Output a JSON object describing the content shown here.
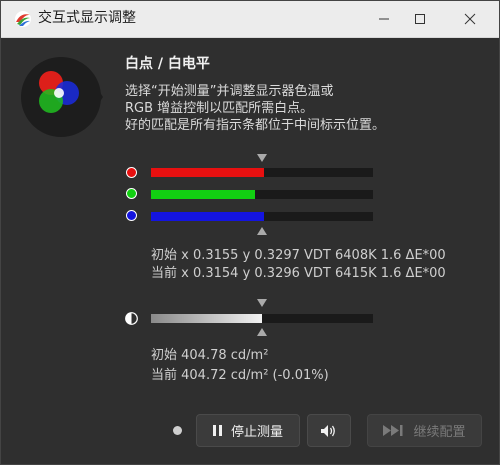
{
  "window": {
    "title": "交互式显示调整"
  },
  "section": {
    "title": "白点 / 白电平",
    "description": [
      "选择“开始测量”并调整显示器色温或",
      "RGB 增益控制以匹配所需白点。",
      "好的匹配是所有指示条都位于中间标示位置。"
    ]
  },
  "rgb_bars": {
    "target_fraction": 0.5,
    "items": [
      {
        "name": "red",
        "color": "#e81010",
        "fraction": 0.51
      },
      {
        "name": "green",
        "color": "#12d012",
        "fraction": 0.47
      },
      {
        "name": "blue",
        "color": "#1414e0",
        "fraction": 0.51
      }
    ]
  },
  "white_point": {
    "initial": "初始 x 0.3155 y 0.3297 VDT 6408K 1.6 ΔE*00",
    "current": "当前 x 0.3154 y 0.3296 VDT 6415K 1.6 ΔE*00"
  },
  "luminance": {
    "fraction": 0.5,
    "target_fraction": 0.5,
    "initial": "初始 404.78 cd/m²",
    "current": "当前 404.72 cd/m² (-0.01%)"
  },
  "buttons": {
    "stop_label": "停止测量",
    "continue_label": "继续配置"
  },
  "colors": {
    "background": "#2f2f2f",
    "track": "#1a1a1a",
    "luminance_bar": "#f2f2f2"
  }
}
